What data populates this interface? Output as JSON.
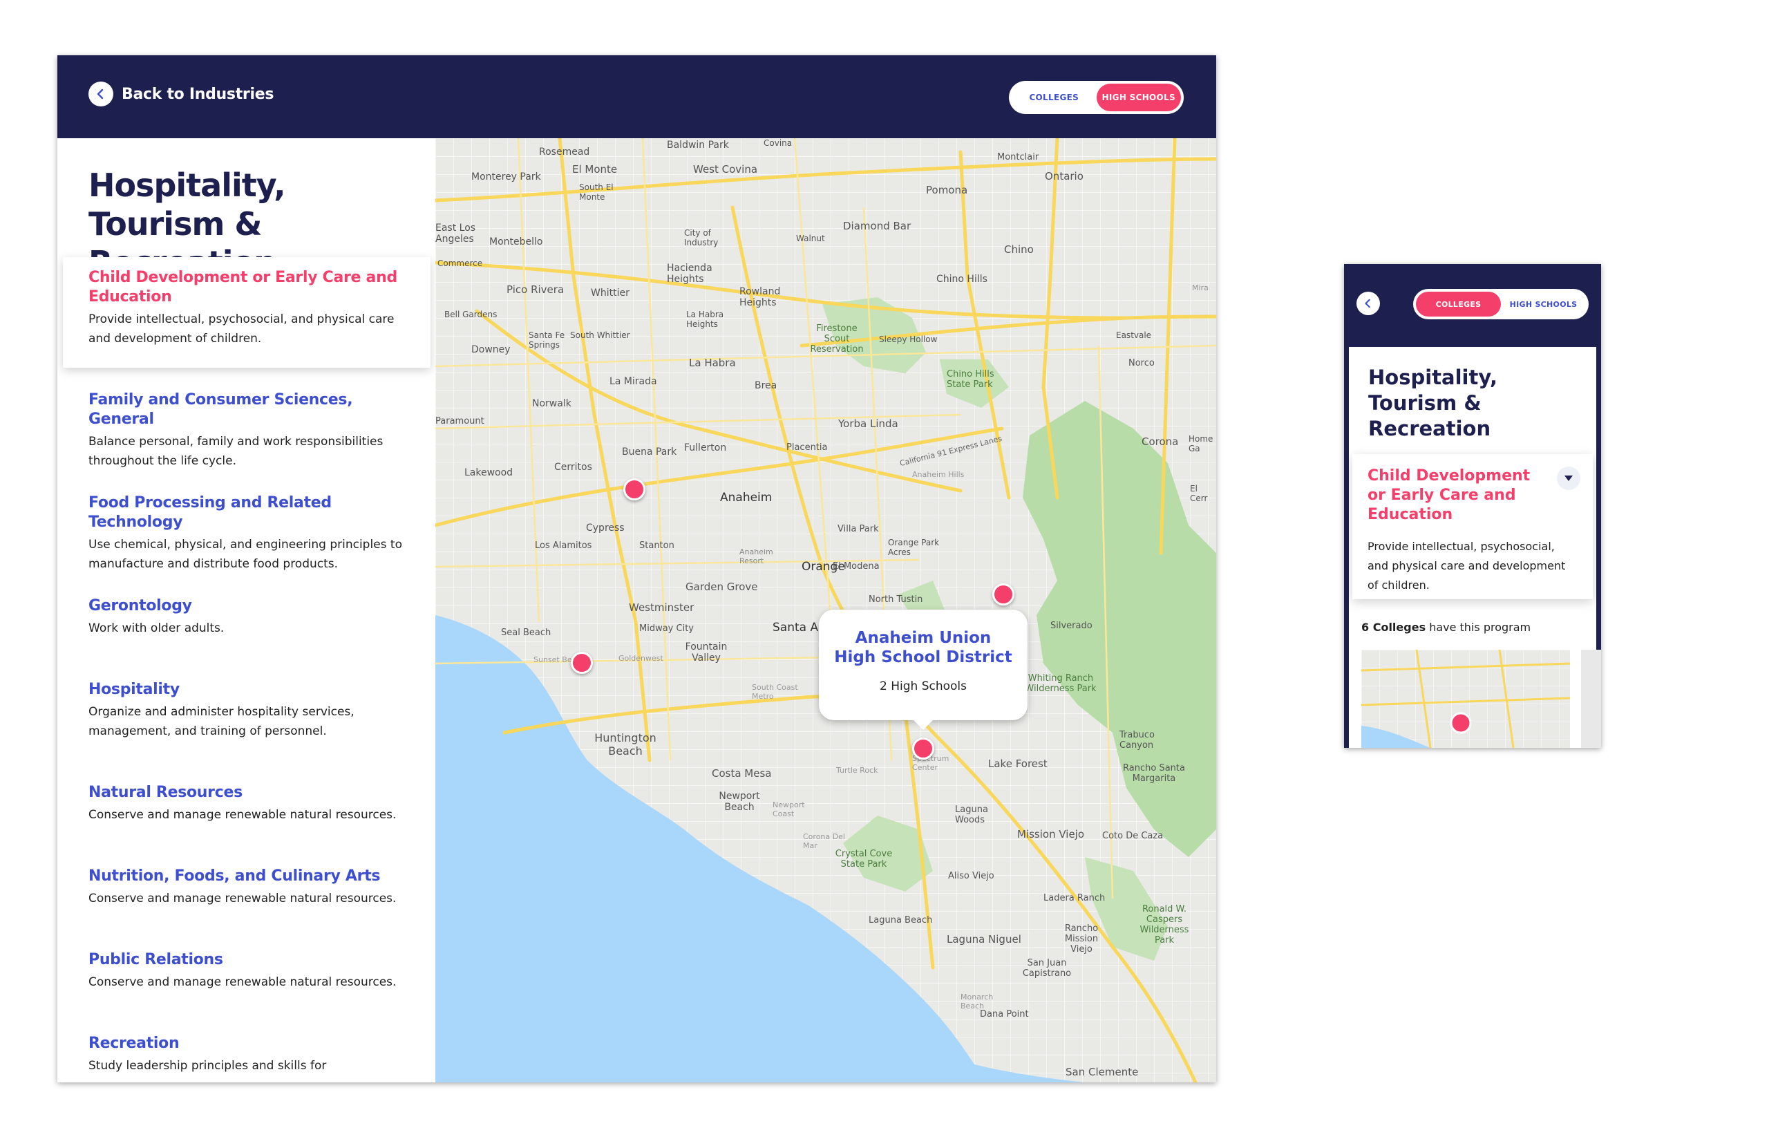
{
  "desktop": {
    "back_label": "Back to Industries",
    "toggle": {
      "colleges": "COLLEGES",
      "high_schools": "HIGH SCHOOLS",
      "active": "high_schools"
    },
    "title": "Hospitality, Tourism & Recreation",
    "programs": [
      {
        "title": "Child Development or Early Care and Education",
        "desc": "Provide intellectual, psychosocial, and physical care and development of children."
      },
      {
        "title": "Family and Consumer Sciences, General",
        "desc": "Balance personal, family and work responsibilities throughout the life cycle."
      },
      {
        "title": "Food Processing and Related Technology",
        "desc": "Use chemical, physical, and engineering principles to manufacture and distribute food products."
      },
      {
        "title": "Gerontology",
        "desc": "Work with older adults."
      },
      {
        "title": "Hospitality",
        "desc": "Organize and administer hospitality services, management, and training of personnel."
      },
      {
        "title": "Natural Resources",
        "desc": "Conserve and manage renewable natural resources."
      },
      {
        "title": "Nutrition, Foods, and Culinary Arts",
        "desc": "Conserve and manage renewable natural resources."
      },
      {
        "title": "Public Relations",
        "desc": "Conserve and manage renewable natural resources."
      },
      {
        "title": "Recreation",
        "desc": "Study leadership principles and skills for"
      }
    ],
    "map": {
      "popup": {
        "title": "Anaheim Union High School District",
        "count": "2 High Schools"
      },
      "labels": [
        "Rosemead",
        "Baldwin Park",
        "Covina",
        "Montclair",
        "El Monte",
        "West Covina",
        "Ontario",
        "Monterey Park",
        "South El Monte",
        "Pomona",
        "Diamond Bar",
        "East Los Angeles",
        "Montebello",
        "City of Industry",
        "Walnut",
        "Chino",
        "Commerce",
        "Hacienda Heights",
        "Pico Rivera",
        "Whittier",
        "Rowland Heights",
        "Chino Hills",
        "Bell Gardens",
        "La Habra Heights",
        "Firestone Scout Reservation",
        "Sleepy Hollow",
        "Eastvale",
        "Downey",
        "Santa Fe Springs",
        "South Whittier",
        "La Habra",
        "Norco",
        "Chino Hills State Park",
        "Norwalk",
        "La Mirada",
        "Brea",
        "Paramount",
        "Yorba Linda",
        "Corona",
        "Home Ga",
        "Buena Park",
        "Fullerton",
        "Placentia",
        "Lakewood",
        "Cerritos",
        "Anaheim",
        "El Cerr",
        "Cypress",
        "Villa Park",
        "Los Alamitos",
        "Stanton",
        "Orange",
        "Orange Park Acres",
        "Anaheim Resort",
        "El Modena",
        "Garden Grove",
        "Westminster",
        "North Tustin",
        "Silverado",
        "Seal Beach",
        "Midway City",
        "Santa Ana",
        "Fountain Valley",
        "Whiting Ranch Wilderness Park",
        "Trabuco Canyon",
        "Huntington Beach",
        "Lake Forest",
        "Rancho Santa Margarita",
        "Costa Mesa",
        "Newport Beach",
        "Laguna Woods",
        "Mission Viejo",
        "Coto De Caza",
        "Crystal Cove State Park",
        "Aliso Viejo",
        "Ladera Ranch",
        "Laguna Beach",
        "Ronald W. Caspers Wilderness Park",
        "Rancho Mission Viejo",
        "Laguna Niguel",
        "San Juan Capistrano",
        "Dana Point",
        "San Clemente",
        "California 91 Express Lanes",
        "Anaheim Hills",
        "Irvine Spectrum Center",
        "Turtle Rock",
        "Sunset Beach",
        "Goldenwest",
        "South Coast Metro",
        "Newport Coast",
        "Corona Del Mar",
        "Monarch Beach",
        "Mira"
      ]
    }
  },
  "mobile": {
    "toggle": {
      "colleges": "COLLEGES",
      "high_schools": "HIGH SCHOOLS",
      "active": "colleges"
    },
    "title": "Hospitality, Tourism & Recreation",
    "selected": {
      "title": "Child Development or Early Care and Education",
      "desc": "Provide intellectual, psychosocial, and physical care and development of children."
    },
    "count_number": "6 Colleges",
    "count_suffix": "have this  program"
  },
  "colors": {
    "navy": "#1d1f4e",
    "accent": "#f53f6b",
    "link": "#3d4fcf",
    "water": "#a9d7fb",
    "park": "#b8dca8",
    "road": "#f8d75a"
  }
}
